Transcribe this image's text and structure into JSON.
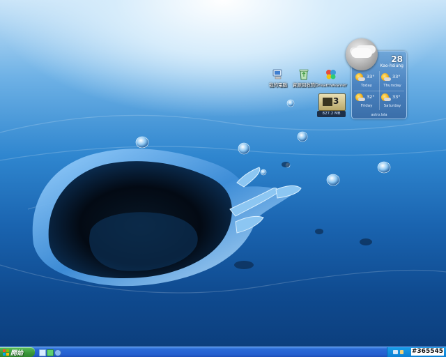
{
  "desktop": {
    "icons": [
      {
        "label": "我的電腦",
        "icon": "computer-icon"
      },
      {
        "label": "資源回收筒",
        "icon": "recycle-bin-icon"
      },
      {
        "label": "Dreamweaver",
        "icon": "msn-butterfly-icon"
      }
    ]
  },
  "weather": {
    "temperature": "28",
    "city": "Kao-hsiung",
    "forecast": [
      {
        "day": "Today",
        "temp": "33°"
      },
      {
        "day": "Thursday",
        "temp": "33°"
      },
      {
        "day": "Friday",
        "temp": "32°"
      },
      {
        "day": "Saturday",
        "temp": "33°"
      }
    ],
    "source": "astro.lola"
  },
  "drive_gadget": {
    "display": "3",
    "free_space": "827.2 MB"
  },
  "taskbar": {
    "start_label": "開始",
    "quick_launch": [
      "ie-icon",
      "desktop-icon",
      "media-icon"
    ],
    "clock": "#365545"
  },
  "colors": {
    "taskbar_blue": "#245fcf",
    "start_green": "#3c9a3c",
    "tray_blue": "#0c80d4"
  }
}
